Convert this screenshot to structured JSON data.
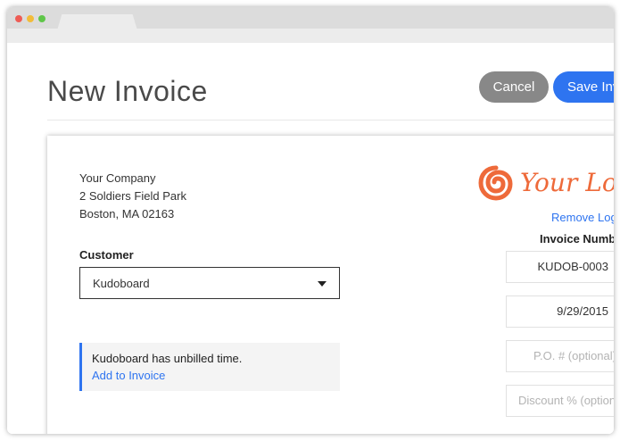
{
  "page": {
    "title": "New Invoice",
    "cancel_label": "Cancel",
    "save_label": "Save Invoice"
  },
  "company": {
    "name": "Your Company",
    "address_line1": "2 Soldiers Field Park",
    "address_line2": "Boston, MA 02163"
  },
  "customer": {
    "label": "Customer",
    "selected": "Kudoboard"
  },
  "notice": {
    "text": "Kudoboard has unbilled time.",
    "link": "Add to Invoice"
  },
  "logo": {
    "text": "Your Logo",
    "remove_label": "Remove Logo"
  },
  "invoice": {
    "number_label": "Invoice Number",
    "number": "KUDOB-0003",
    "date": "9/29/2015",
    "po_placeholder": "P.O. # (optional)",
    "discount_placeholder": "Discount % (optional)"
  },
  "colors": {
    "accent": "#2e74f0",
    "cancel_bg": "#888888",
    "logo": "#ee6a3a"
  }
}
